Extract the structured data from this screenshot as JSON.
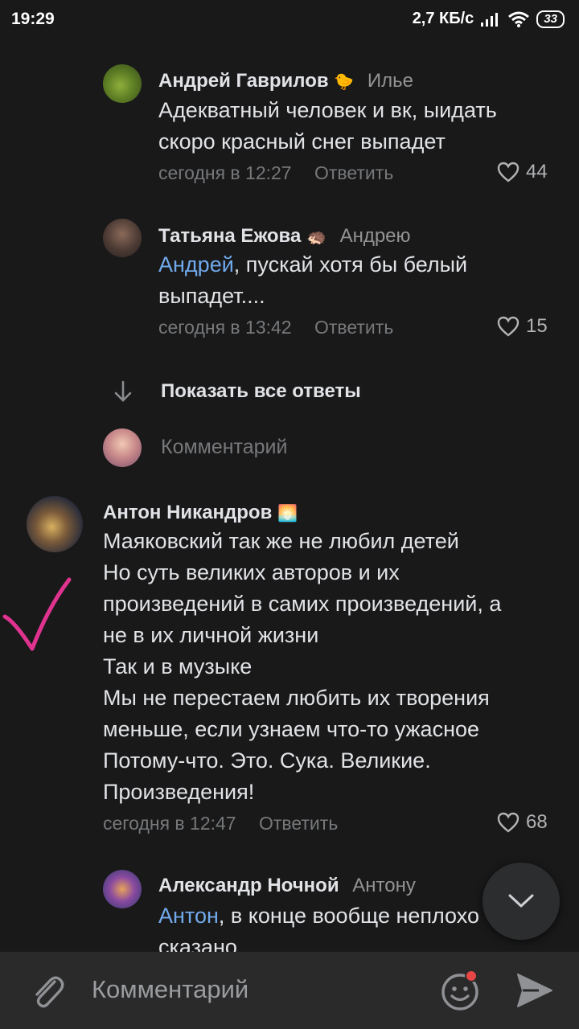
{
  "status_bar": {
    "time": "19:29",
    "speed": "2,7 КБ/с",
    "battery": "33"
  },
  "comments": [
    {
      "author": "Андрей Гаврилов",
      "emoji": "🐤",
      "reply_to": "Илье",
      "text_lines": [
        "Адекватный человек и вк, ыидать",
        "скоро красный снег выпадет"
      ],
      "time": "сегодня в 12:27",
      "reply_label": "Ответить",
      "likes": "44"
    },
    {
      "author": "Татьяна Ежова",
      "emoji": "🦔",
      "reply_to": "Андрею",
      "mention": "Андрей",
      "text_rest": ", пускай хотя бы белый",
      "text_line2": "выпадет....",
      "time": "сегодня в 13:42",
      "reply_label": "Ответить",
      "likes": "15"
    }
  ],
  "show_all_replies": "Показать все ответы",
  "inline_comment_placeholder": "Комментарий",
  "main_comment": {
    "author": "Антон Никандров",
    "emoji": "🌅",
    "text_lines": [
      "Маяковский так же не любил детей",
      "Но суть великих авторов и их",
      "произведений в самих произведений, а",
      "не в их личной жизни",
      "Так и в музыке",
      "Мы не перестаем любить их творения",
      "меньше, если узнаем что-то ужасное",
      "Потому-что. Это. Сука. Великие.",
      "Произведения!"
    ],
    "time": "сегодня в 12:47",
    "reply_label": "Ответить",
    "likes": "68"
  },
  "reply_comment": {
    "author": "Александр Ночной",
    "reply_to": "Антону",
    "mention": "Антон",
    "text_rest": ", в конце вообще неплохо",
    "text_line2": "сказано"
  },
  "bottom_bar": {
    "placeholder": "Комментарий"
  },
  "colors": {
    "background": "#19191a",
    "mention": "#71aaeb",
    "checkmark": "#e0338f",
    "notification_dot": "#e64646"
  }
}
